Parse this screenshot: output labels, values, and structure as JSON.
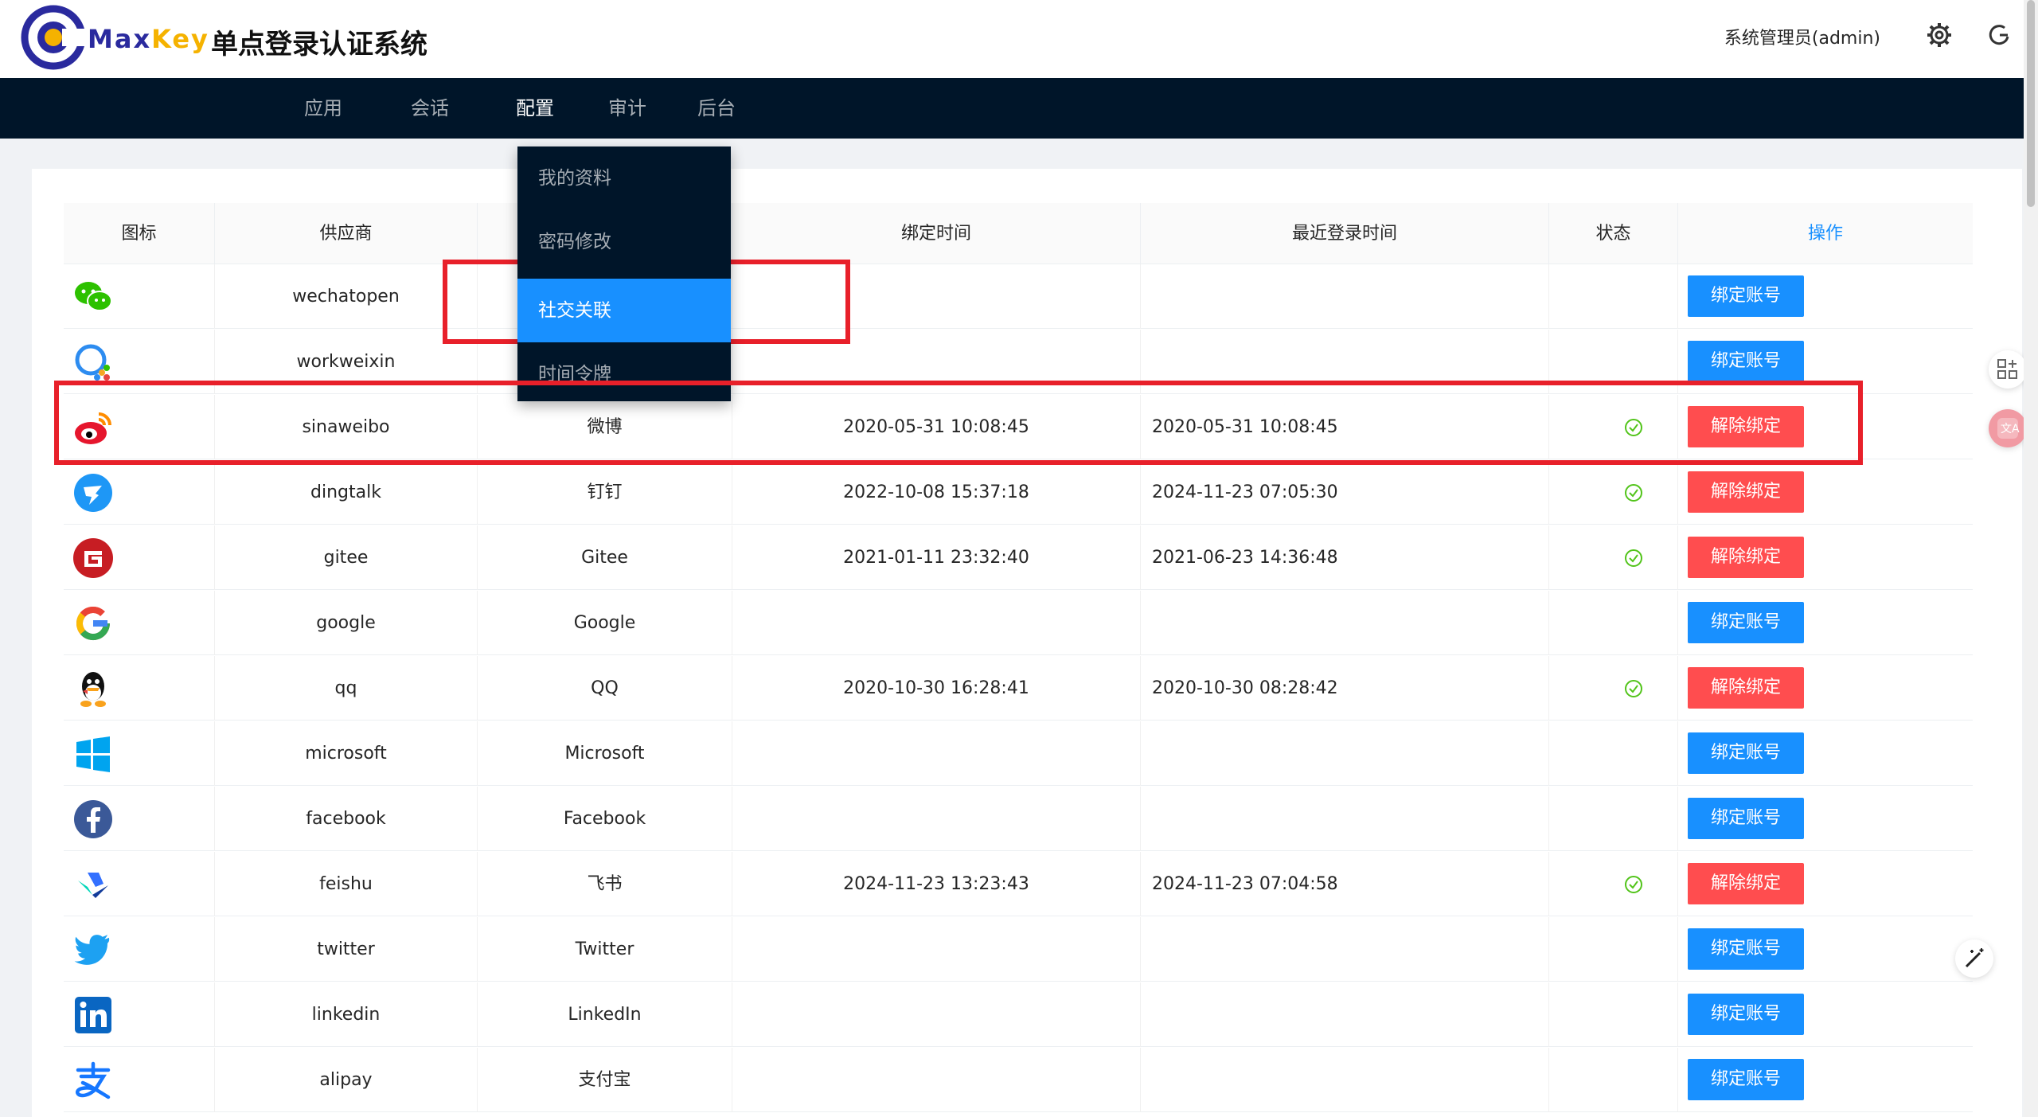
{
  "header": {
    "brand_part1": "Max",
    "brand_part2": "Key",
    "system_title": "单点登录认证系统",
    "user": "系统管理员(admin)"
  },
  "nav": [
    {
      "label": "应用"
    },
    {
      "label": "会话"
    },
    {
      "label": "配置"
    },
    {
      "label": "审计"
    },
    {
      "label": "后台"
    }
  ],
  "dropdown": [
    {
      "label": "我的资料"
    },
    {
      "label": "密码修改"
    },
    {
      "label": "社交关联"
    },
    {
      "label": "时间令牌"
    }
  ],
  "table": {
    "headers": [
      "图标",
      "供应商",
      "",
      "绑定时间",
      "最近登录时间",
      "状态",
      "操作"
    ],
    "rows": [
      {
        "provider": "wechatopen",
        "name": "",
        "bind_time": "",
        "last_login": "",
        "bound": false,
        "action": "绑定账号",
        "icon": "wechat-icon"
      },
      {
        "provider": "workweixin",
        "name": "",
        "bind_time": "",
        "last_login": "",
        "bound": false,
        "action": "绑定账号",
        "icon": "workweixin-icon"
      },
      {
        "provider": "sinaweibo",
        "name": "微博",
        "bind_time": "2020-05-31 10:08:45",
        "last_login": "2020-05-31 10:08:45",
        "bound": true,
        "action": "解除绑定",
        "icon": "weibo-icon"
      },
      {
        "provider": "dingtalk",
        "name": "钉钉",
        "bind_time": "2022-10-08 15:37:18",
        "last_login": "2024-11-23 07:05:30",
        "bound": true,
        "action": "解除绑定",
        "icon": "dingtalk-icon"
      },
      {
        "provider": "gitee",
        "name": "Gitee",
        "bind_time": "2021-01-11 23:32:40",
        "last_login": "2021-06-23 14:36:48",
        "bound": true,
        "action": "解除绑定",
        "icon": "gitee-icon"
      },
      {
        "provider": "google",
        "name": "Google",
        "bind_time": "",
        "last_login": "",
        "bound": false,
        "action": "绑定账号",
        "icon": "google-icon"
      },
      {
        "provider": "qq",
        "name": "QQ",
        "bind_time": "2020-10-30 16:28:41",
        "last_login": "2020-10-30 08:28:42",
        "bound": true,
        "action": "解除绑定",
        "icon": "qq-icon"
      },
      {
        "provider": "microsoft",
        "name": "Microsoft",
        "bind_time": "",
        "last_login": "",
        "bound": false,
        "action": "绑定账号",
        "icon": "microsoft-icon"
      },
      {
        "provider": "facebook",
        "name": "Facebook",
        "bind_time": "",
        "last_login": "",
        "bound": false,
        "action": "绑定账号",
        "icon": "facebook-icon"
      },
      {
        "provider": "feishu",
        "name": "飞书",
        "bind_time": "2024-11-23 13:23:43",
        "last_login": "2024-11-23 07:04:58",
        "bound": true,
        "action": "解除绑定",
        "icon": "feishu-icon"
      },
      {
        "provider": "twitter",
        "name": "Twitter",
        "bind_time": "",
        "last_login": "",
        "bound": false,
        "action": "绑定账号",
        "icon": "twitter-icon"
      },
      {
        "provider": "linkedin",
        "name": "LinkedIn",
        "bind_time": "",
        "last_login": "",
        "bound": false,
        "action": "绑定账号",
        "icon": "linkedin-icon"
      },
      {
        "provider": "alipay",
        "name": "支付宝",
        "bind_time": "",
        "last_login": "",
        "bound": false,
        "action": "绑定账号",
        "icon": "alipay-icon"
      }
    ]
  },
  "colors": {
    "nav_bg": "#001529",
    "primary": "#1890ff",
    "danger": "#ff4d4f",
    "success": "#52c41a",
    "annotation": "#e8202a"
  }
}
